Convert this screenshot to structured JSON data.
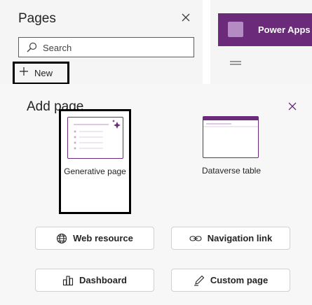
{
  "pages_panel": {
    "title": "Pages",
    "search": {
      "placeholder": "Search"
    },
    "new_label": "New"
  },
  "app_preview": {
    "title": "Power Apps"
  },
  "add_page": {
    "title": "Add page",
    "cards": [
      {
        "label": "Generative page",
        "icon": "generative-page-thumbnail"
      },
      {
        "label": "Dataverse table",
        "icon": "dataverse-table-thumbnail"
      }
    ],
    "options": [
      {
        "label": "Web resource",
        "icon": "globe-icon"
      },
      {
        "label": "Navigation link",
        "icon": "link-icon"
      },
      {
        "label": "Dashboard",
        "icon": "dashboard-icon"
      },
      {
        "label": "Custom page",
        "icon": "pen-icon"
      }
    ]
  },
  "colors": {
    "brand": "#6b2b7a",
    "panel_bg": "#f5f5f5",
    "highlight_border": "#000000"
  }
}
